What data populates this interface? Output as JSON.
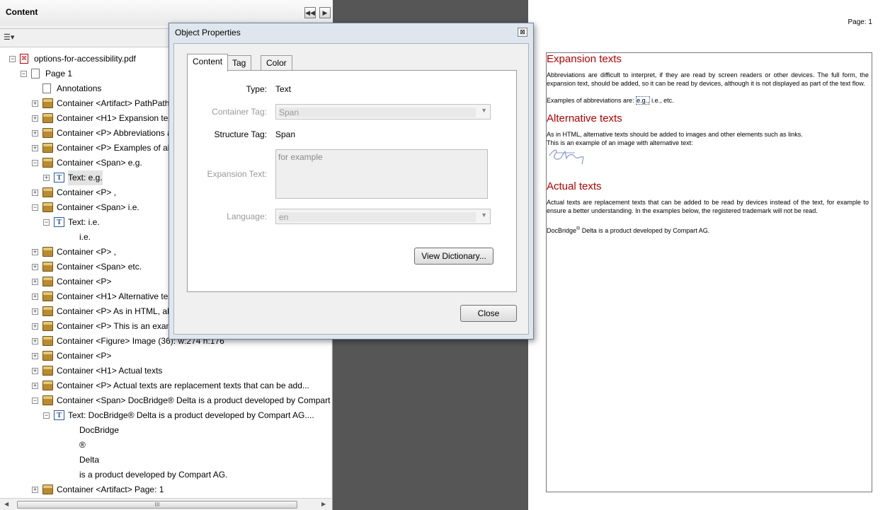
{
  "panel": {
    "title": "Content",
    "rewind_icon": "rewind-icon",
    "forward_icon": "play-icon",
    "options_icon": "options-menu-icon",
    "tree": [
      {
        "level": 0,
        "expander": "−",
        "icon": "pdf-icon",
        "label": "options-for-accessibility.pdf"
      },
      {
        "level": 1,
        "expander": "−",
        "icon": "page-icon",
        "label": "Page 1"
      },
      {
        "level": 2,
        "expander": "",
        "icon": "page-icon",
        "label": "Annotations"
      },
      {
        "level": 2,
        "expander": "+",
        "icon": "container-icon",
        "label": "Container <Artifact> PathPath"
      },
      {
        "level": 2,
        "expander": "+",
        "icon": "container-icon",
        "label": "Container <H1> Expansion texts"
      },
      {
        "level": 2,
        "expander": "+",
        "icon": "container-icon",
        "label": "Container <P> Abbreviations are difficult"
      },
      {
        "level": 2,
        "expander": "+",
        "icon": "container-icon",
        "label": "Container <P> Examples of abbreviations"
      },
      {
        "level": 2,
        "expander": "−",
        "icon": "container-icon",
        "label": "Container <Span> e.g."
      },
      {
        "level": 3,
        "expander": "+",
        "icon": "text-icon",
        "label": "Text: e.g.",
        "selected": true
      },
      {
        "level": 2,
        "expander": "+",
        "icon": "container-icon",
        "label": "Container <P> ,"
      },
      {
        "level": 2,
        "expander": "−",
        "icon": "container-icon",
        "label": "Container <Span> i.e."
      },
      {
        "level": 3,
        "expander": "−",
        "icon": "text-icon",
        "label": "Text: i.e."
      },
      {
        "level": 4,
        "expander": "",
        "icon": "",
        "label": "i.e."
      },
      {
        "level": 2,
        "expander": "+",
        "icon": "container-icon",
        "label": "Container <P> ,"
      },
      {
        "level": 2,
        "expander": "+",
        "icon": "container-icon",
        "label": "Container <Span> etc."
      },
      {
        "level": 2,
        "expander": "+",
        "icon": "container-icon",
        "label": "Container <P>"
      },
      {
        "level": 2,
        "expander": "+",
        "icon": "container-icon",
        "label": "Container <H1> Alternative texts"
      },
      {
        "level": 2,
        "expander": "+",
        "icon": "container-icon",
        "label": "Container <P> As in HTML, alternative"
      },
      {
        "level": 2,
        "expander": "+",
        "icon": "container-icon",
        "label": "Container <P> This is an example"
      },
      {
        "level": 2,
        "expander": "+",
        "icon": "container-icon",
        "label": "Container <Figure> Image (36): w:274 h:176"
      },
      {
        "level": 2,
        "expander": "+",
        "icon": "container-icon",
        "label": "Container <P>"
      },
      {
        "level": 2,
        "expander": "+",
        "icon": "container-icon",
        "label": "Container <H1> Actual texts"
      },
      {
        "level": 2,
        "expander": "+",
        "icon": "container-icon",
        "label": "Container <P> Actual texts are replacement texts that can be add..."
      },
      {
        "level": 2,
        "expander": "−",
        "icon": "container-icon",
        "label": "Container <Span> DocBridge® Delta is a product developed by Compart"
      },
      {
        "level": 3,
        "expander": "−",
        "icon": "text-icon",
        "label": "Text: DocBridge® Delta is a product developed by Compart AG...."
      },
      {
        "level": 4,
        "expander": "",
        "icon": "",
        "label": "DocBridge"
      },
      {
        "level": 4,
        "expander": "",
        "icon": "",
        "label": "®"
      },
      {
        "level": 4,
        "expander": "",
        "icon": "",
        "label": "Delta"
      },
      {
        "level": 4,
        "expander": "",
        "icon": "",
        "label": "is a product developed by Compart AG."
      },
      {
        "level": 2,
        "expander": "+",
        "icon": "container-icon",
        "label": "Container <Artifact> Page: 1"
      }
    ],
    "scroll_grip": "III"
  },
  "dialog": {
    "title": "Object Properties",
    "close_glyph": "⊠",
    "tabs": [
      "Content",
      "Tag",
      "Color"
    ],
    "active_tab": "Content",
    "fields": {
      "type_label": "Type:",
      "type_value": "Text",
      "container_tag_label": "Container Tag:",
      "container_tag_value": "Span",
      "structure_tag_label": "Structure Tag:",
      "structure_tag_value": "Span",
      "expansion_text_label": "Expansion Text:",
      "expansion_text_value": "for example",
      "language_label": "Language:",
      "language_value": "en"
    },
    "view_dictionary_label": "View Dictionary...",
    "close_label": "Close"
  },
  "document": {
    "page_label": "Page: 1",
    "heading1": "Expansion texts",
    "para1": "Abbreviations are difficult to interpret, if they are read by screen readers or other devices. The full form, the expansion text, should be added, so it can be read by devices, although it is not displayed as part of the text flow.",
    "para2_prefix": "Examples of abbreviations are: ",
    "para2_highlight": "e.g.,",
    "para2_suffix": " i.e., etc.",
    "heading2": "Alternative texts",
    "para3": "As in HTML, alternative texts should be added to images and other elements such as links.",
    "para4": "This is an example of an image with alternative text:",
    "heading3": "Actual texts",
    "para5": "Actual texts are replacement texts that can be added to be read by devices instead of the text, for example to ensure a better understanding. In the examples below, the registered trademark will not be read.",
    "para6_a": "DocBridge",
    "para6_sup": "®",
    "para6_b": " Delta is a product developed by Compart AG."
  }
}
